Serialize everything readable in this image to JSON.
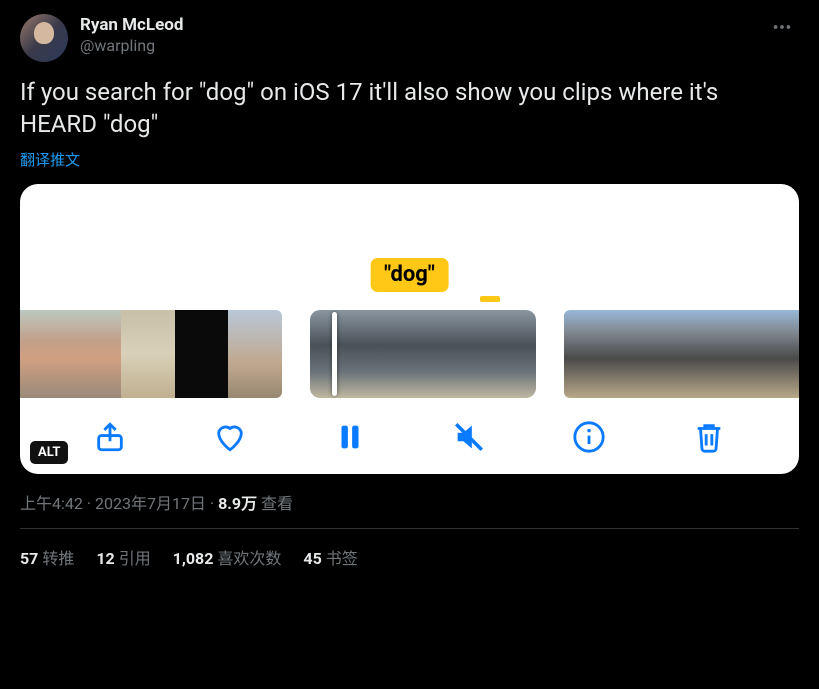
{
  "author": {
    "display_name": "Ryan McLeod",
    "handle": "@warpling"
  },
  "tweet_text": "If you search for \"dog\" on iOS 17 it'll also show you clips where it's HEARD \"dog\"",
  "translate_label": "翻译推文",
  "media": {
    "search_term_label": "\"dog\"",
    "alt_badge": "ALT",
    "toolbar_icons": {
      "share": "share-icon",
      "like": "heart-icon",
      "pause": "pause-icon",
      "mute": "volume-muted-icon",
      "info": "info-icon",
      "delete": "trash-icon"
    }
  },
  "meta": {
    "time": "上午4:42",
    "dot1": " · ",
    "date": "2023年7月17日",
    "dot2": " · ",
    "view_count": "8.9万",
    "view_label": " 查看"
  },
  "stats": {
    "retweets": {
      "count": "57",
      "label": "转推"
    },
    "quotes": {
      "count": "12",
      "label": "引用"
    },
    "likes": {
      "count": "1,082",
      "label": "喜欢次数"
    },
    "bookmarks": {
      "count": "45",
      "label": "书签"
    }
  }
}
